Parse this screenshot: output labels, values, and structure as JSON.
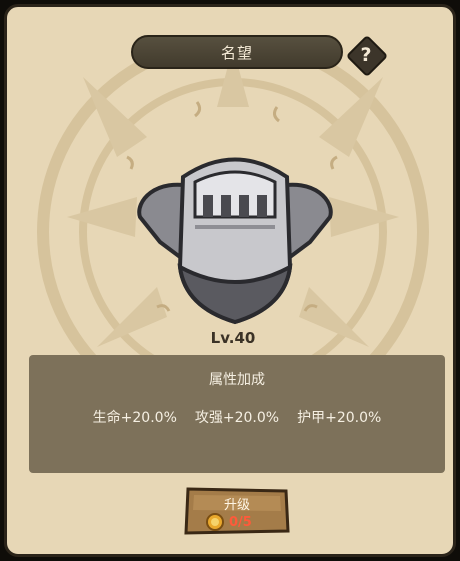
{
  "header": {
    "title": "名望",
    "help_label": "?"
  },
  "item": {
    "level_label": "Lv.40",
    "icon": "knight-helmet-armor-icon"
  },
  "attributes": {
    "title": "属性加成",
    "stats": [
      "生命+20.0%",
      "攻强+20.0%",
      "护甲+20.0%"
    ]
  },
  "upgrade": {
    "label": "升级",
    "cost": "0/5",
    "cost_icon": "gold-coin-icon"
  },
  "colors": {
    "panel_bg": "#e7d7b6",
    "title_bar": "#4b4435",
    "info_box": "#7d715a",
    "button_wood": "#a47c49",
    "cost_text": "#ff5a3a"
  }
}
